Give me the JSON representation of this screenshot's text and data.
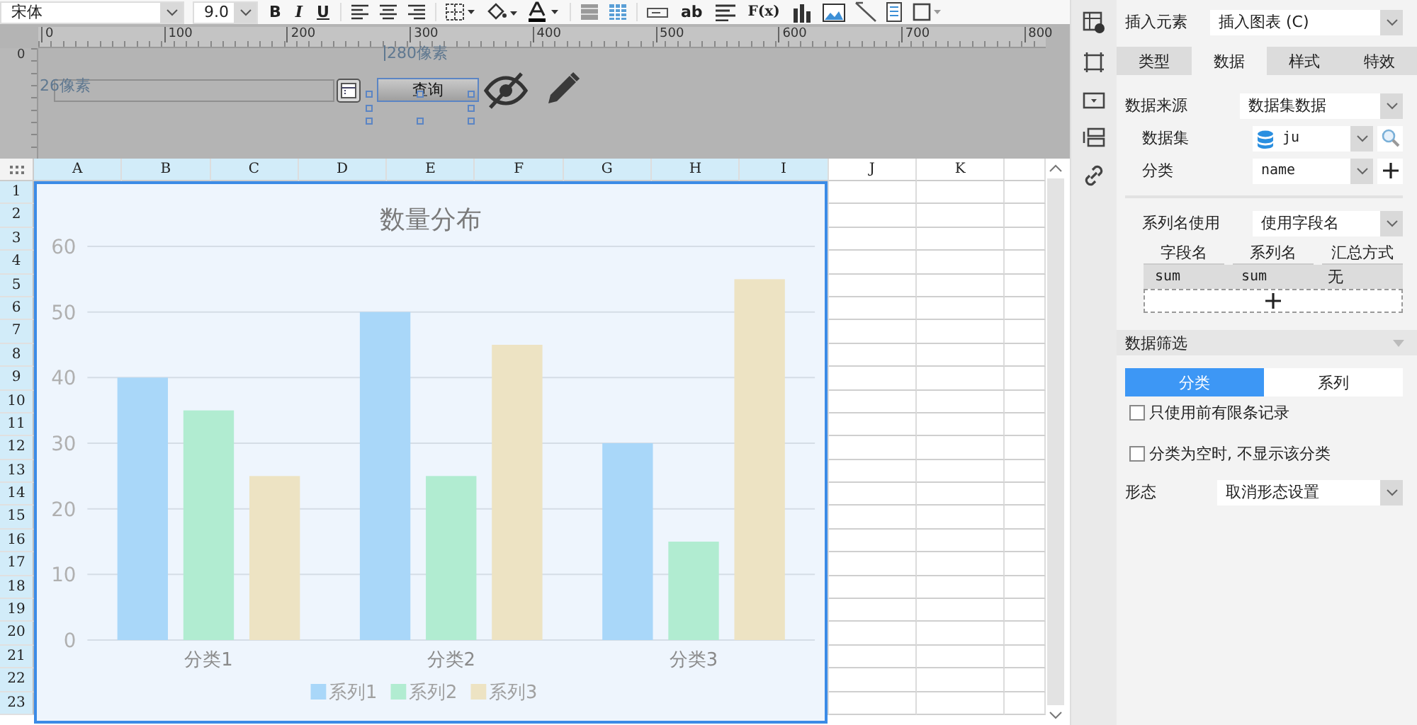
{
  "toolbar": {
    "font": "宋体",
    "font_size": "9.0",
    "bold": "B",
    "italic": "I",
    "underline": "U",
    "text_widget": "ab",
    "formula": "F(x)"
  },
  "ruler": {
    "labels": [
      "0",
      "100",
      "200",
      "300",
      "400",
      "500",
      "600",
      "700",
      "800"
    ],
    "vertical_label": "0"
  },
  "form_preview": {
    "width_label": "280像素",
    "height_label": "26像素",
    "query_button": "查询",
    "button_selected": true
  },
  "sheet": {
    "columns": [
      {
        "label": "A",
        "selected": true
      },
      {
        "label": "B",
        "selected": true
      },
      {
        "label": "C",
        "selected": true
      },
      {
        "label": "D",
        "selected": true
      },
      {
        "label": "E",
        "selected": true
      },
      {
        "label": "F",
        "selected": true
      },
      {
        "label": "G",
        "selected": true
      },
      {
        "label": "H",
        "selected": true
      },
      {
        "label": "I",
        "selected": true
      },
      {
        "label": "J",
        "selected": false
      },
      {
        "label": "K",
        "selected": false
      }
    ],
    "rows": [
      "1",
      "2",
      "3",
      "4",
      "5",
      "6",
      "7",
      "8",
      "9",
      "10",
      "11",
      "12",
      "13",
      "14",
      "15",
      "16",
      "17",
      "18",
      "19",
      "20",
      "21",
      "22",
      "23"
    ],
    "chart": {
      "chart_data": {
        "type": "bar",
        "title": "数量分布",
        "categories": [
          "分类1",
          "分类2",
          "分类3"
        ],
        "series": [
          {
            "name": "系列1",
            "color": "#a9d7f9",
            "values": [
              40,
              50,
              30
            ]
          },
          {
            "name": "系列2",
            "color": "#b1ecd1",
            "values": [
              35,
              25,
              15
            ]
          },
          {
            "name": "系列3",
            "color": "#ede3c3",
            "values": [
              25,
              45,
              55
            ]
          }
        ],
        "grid": true,
        "legend": true,
        "ylim": [
          0,
          60
        ],
        "yticks": [
          0,
          10,
          20,
          30,
          40,
          50,
          60
        ]
      }
    }
  },
  "panel": {
    "insert_label": "插入元素",
    "insert_value": "插入图表 (C)",
    "tabs": [
      {
        "label": "类型",
        "selected": false
      },
      {
        "label": "数据",
        "selected": true
      },
      {
        "label": "样式",
        "selected": false
      },
      {
        "label": "特效",
        "selected": false
      }
    ],
    "source_label": "数据来源",
    "source_value": "数据集数据",
    "dataset_label": "数据集",
    "dataset_value": "ju",
    "category_label": "分类",
    "category_value": "name",
    "series_name_label": "系列名使用",
    "series_name_value": "使用字段名",
    "field_columns": [
      "字段名",
      "系列名",
      "汇总方式"
    ],
    "field_rows": [
      [
        "sum",
        "sum",
        "无"
      ]
    ],
    "filter_title": "数据筛选",
    "filter_tabs": [
      {
        "label": "分类",
        "selected": true
      },
      {
        "label": "系列",
        "selected": false
      }
    ],
    "checkboxes": [
      {
        "label": "只使用前有限条记录",
        "checked": false
      },
      {
        "label": "分类为空时, 不显示该分类",
        "checked": false
      }
    ],
    "form_label": "形态",
    "form_value": "取消形态设置"
  }
}
